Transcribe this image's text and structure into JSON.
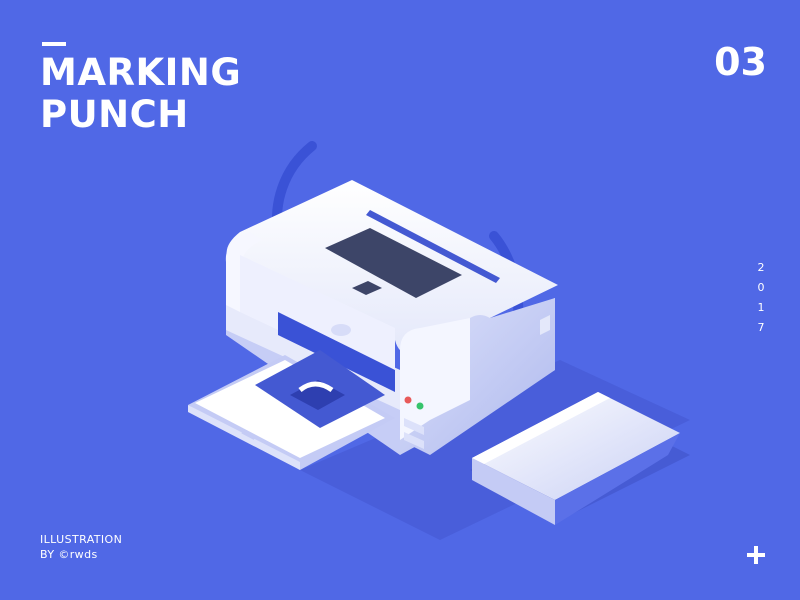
{
  "header": {
    "title_line1": "MARKING",
    "title_line2": "PUNCH",
    "number": "03"
  },
  "side": {
    "year_digits": [
      "2",
      "0",
      "1",
      "7"
    ]
  },
  "footer": {
    "line1": "ILLUSTRATION",
    "line2": "BY ©rwds"
  },
  "icons": {
    "add": "plus-icon"
  },
  "colors": {
    "background": "#5068E6",
    "text": "#FFFFFF",
    "printer_body": "#F0F2FF",
    "screen": "#3D4568",
    "accent": "#3A52D6",
    "led_red": "#E85A5A",
    "led_green": "#36C46C"
  }
}
